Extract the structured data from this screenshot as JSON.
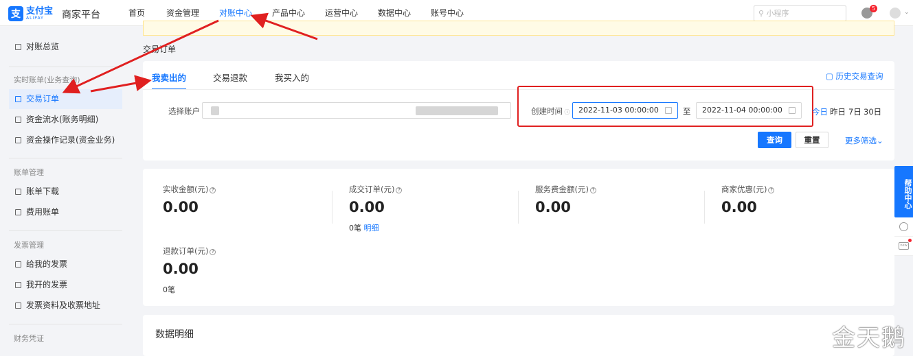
{
  "header": {
    "logo_cn": "支付宝",
    "logo_en": "ALIPAY",
    "platform": "商家平台",
    "nav": [
      {
        "label": "首页"
      },
      {
        "label": "资金管理"
      },
      {
        "label": "对账中心"
      },
      {
        "label": "产品中心"
      },
      {
        "label": "运营中心"
      },
      {
        "label": "数据中心"
      },
      {
        "label": "账号中心"
      }
    ],
    "active_nav": "对账中心",
    "search_placeholder": "小程序",
    "notification_count": "5"
  },
  "sidebar": {
    "overview": "对账总览",
    "groups": [
      {
        "title": "实时账单(业务查询)",
        "items": [
          "交易订单",
          "资金流水(账务明细)",
          "资金操作记录(资金业务)"
        ]
      },
      {
        "title": "账单管理",
        "items": [
          "账单下载",
          "费用账单"
        ]
      },
      {
        "title": "发票管理",
        "items": [
          "给我的发票",
          "我开的发票",
          "发票资料及收票地址"
        ]
      },
      {
        "title": "财务凭证",
        "items": []
      }
    ],
    "active_item": "交易订单"
  },
  "page": {
    "breadcrumb": "交易订单",
    "tabs": [
      "我卖出的",
      "交易退款",
      "我买入的"
    ],
    "active_tab": "我卖出的",
    "history_link": "历史交易查询",
    "filters": {
      "account_label": "选择账户",
      "time_label": "创建时间",
      "start_time": "2022-11-03 00:00:00",
      "to_label": "至",
      "end_time": "2022-11-04 00:00:00",
      "quick_ranges": [
        "今日",
        "昨日",
        "7日",
        "30日"
      ]
    },
    "buttons": {
      "query": "查询",
      "reset": "重置",
      "more_filters": "更多筛选"
    },
    "stats": [
      {
        "label": "实收金额(元)",
        "value": "0.00",
        "sub": ""
      },
      {
        "label": "成交订单(元)",
        "value": "0.00",
        "sub": "0笔",
        "sub_link": "明细"
      },
      {
        "label": "服务费金额(元)",
        "value": "0.00",
        "sub": ""
      },
      {
        "label": "商家优惠(元)",
        "value": "0.00",
        "sub": ""
      },
      {
        "label": "退款订单(元)",
        "value": "0.00",
        "sub": "0笔"
      }
    ],
    "detail_title": "数据明细"
  },
  "help": {
    "label": "帮助中心",
    "new_label": "new"
  },
  "watermark": "金天鹅",
  "colors": {
    "accent": "#1677ff",
    "annotation_red": "#e02020"
  }
}
